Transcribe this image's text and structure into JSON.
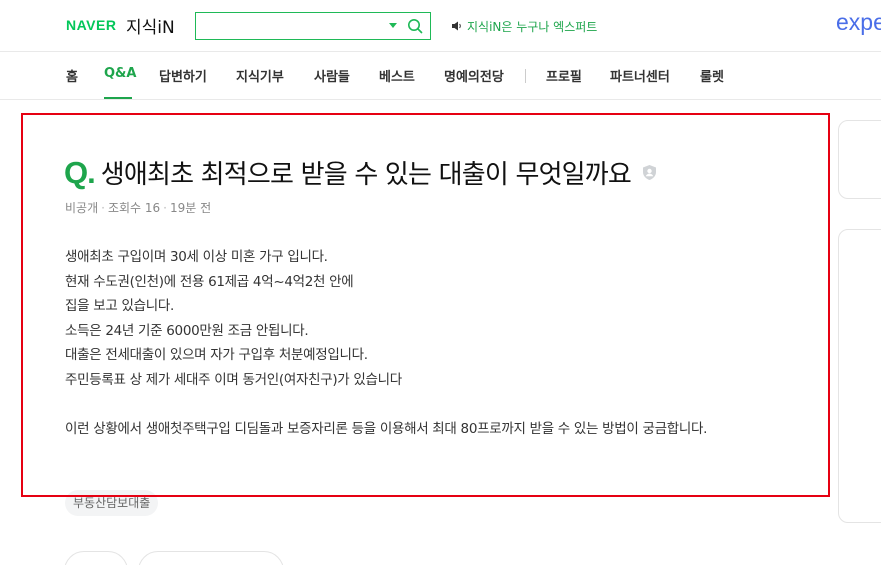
{
  "header": {
    "naver_logo": "NAVER",
    "service_name": "지식iN",
    "search": {
      "value": "",
      "placeholder": ""
    },
    "notice": "지식iN은 누구나 엑스퍼트",
    "expert_logo": "expe"
  },
  "nav": {
    "items": [
      {
        "label": "홈"
      },
      {
        "label": "Q&A",
        "active": true
      },
      {
        "label": "답변하기"
      },
      {
        "label": "지식기부"
      },
      {
        "label": "사람들"
      },
      {
        "label": "베스트"
      },
      {
        "label": "명예의전당"
      },
      {
        "label": "프로필"
      },
      {
        "label": "파트너센터"
      },
      {
        "label": "룰렛"
      }
    ]
  },
  "question": {
    "q_mark": "Q.",
    "title": "생애최초 최적으로 받을 수 있는 대출이 무엇일까요",
    "meta": {
      "visibility": "비공개",
      "views": "조회수 16",
      "time": "19분 전"
    },
    "body_lines": [
      "생애최초 구입이며 30세 이상 미혼 가구 입니다.",
      "현재 수도권(인천)에 전용 61제곱 4억~4억2천 안에",
      "집을 보고 있습니다.",
      "소득은 24년 기준 6000만원 조금 안됩니다.",
      "대출은 전세대출이 있으며 자가 구입후 처분예정입니다.",
      "주민등록표 상 제가 세대주 이며 동거인(여자친구)가 있습니다"
    ],
    "body_paragraph2": "이런 상황에서 생애첫주택구입 디딤돌과 보증자리론 등을 이용해서 최대 80프로까지 받을 수 있는 방법이 궁금합니다.",
    "tag": "부동산담보대출"
  },
  "colors": {
    "accent_green": "#1ea54c",
    "naver_green": "#03c75a",
    "highlight_red": "#e60012",
    "expert_blue": "#4a6ee8"
  }
}
